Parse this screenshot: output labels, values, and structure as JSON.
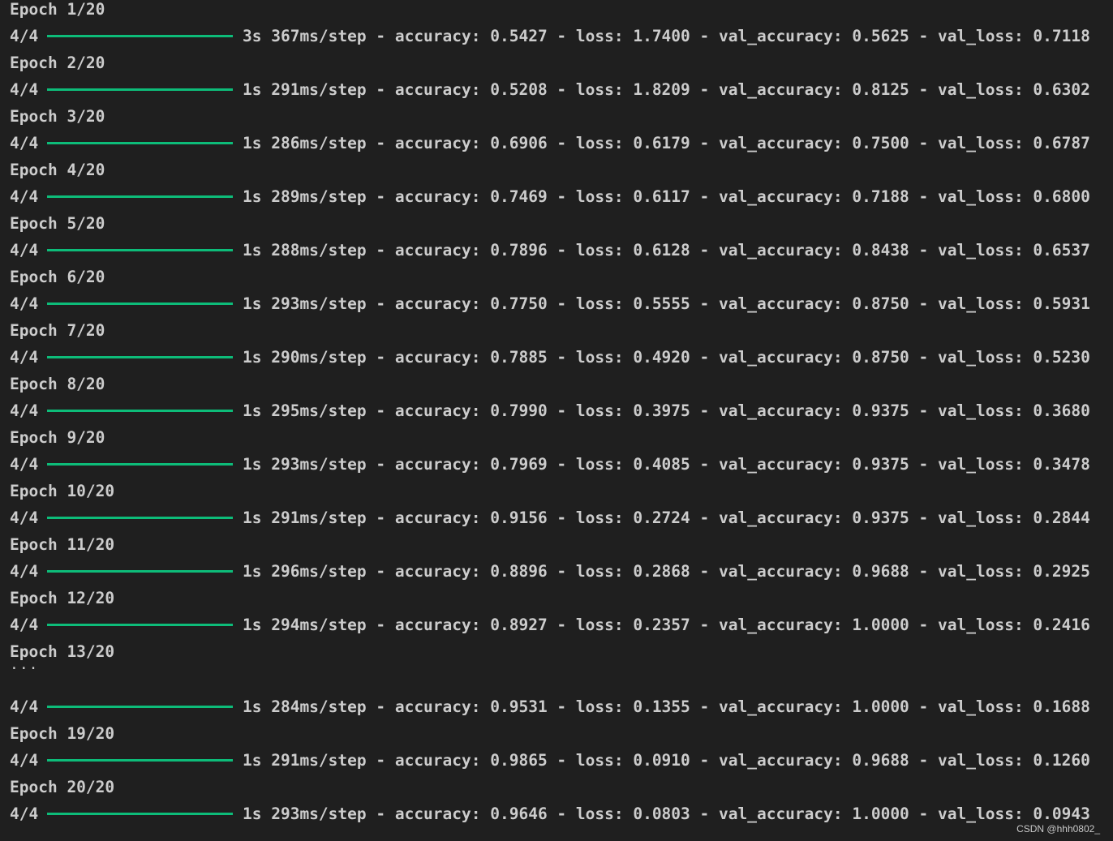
{
  "terminal": {
    "blocks": [
      {
        "epoch": "Epoch 1/20",
        "steps": "4/4",
        "stats": "3s 367ms/step - accuracy: 0.5427 - loss: 1.7400 - val_accuracy: 0.5625 - val_loss: 0.7118"
      },
      {
        "epoch": "Epoch 2/20",
        "steps": "4/4",
        "stats": "1s 291ms/step - accuracy: 0.5208 - loss: 1.8209 - val_accuracy: 0.8125 - val_loss: 0.6302"
      },
      {
        "epoch": "Epoch 3/20",
        "steps": "4/4",
        "stats": "1s 286ms/step - accuracy: 0.6906 - loss: 0.6179 - val_accuracy: 0.7500 - val_loss: 0.6787"
      },
      {
        "epoch": "Epoch 4/20",
        "steps": "4/4",
        "stats": "1s 289ms/step - accuracy: 0.7469 - loss: 0.6117 - val_accuracy: 0.7188 - val_loss: 0.6800"
      },
      {
        "epoch": "Epoch 5/20",
        "steps": "4/4",
        "stats": "1s 288ms/step - accuracy: 0.7896 - loss: 0.6128 - val_accuracy: 0.8438 - val_loss: 0.6537"
      },
      {
        "epoch": "Epoch 6/20",
        "steps": "4/4",
        "stats": "1s 293ms/step - accuracy: 0.7750 - loss: 0.5555 - val_accuracy: 0.8750 - val_loss: 0.5931"
      },
      {
        "epoch": "Epoch 7/20",
        "steps": "4/4",
        "stats": "1s 290ms/step - accuracy: 0.7885 - loss: 0.4920 - val_accuracy: 0.8750 - val_loss: 0.5230"
      },
      {
        "epoch": "Epoch 8/20",
        "steps": "4/4",
        "stats": "1s 295ms/step - accuracy: 0.7990 - loss: 0.3975 - val_accuracy: 0.9375 - val_loss: 0.3680"
      },
      {
        "epoch": "Epoch 9/20",
        "steps": "4/4",
        "stats": "1s 293ms/step - accuracy: 0.7969 - loss: 0.4085 - val_accuracy: 0.9375 - val_loss: 0.3478"
      },
      {
        "epoch": "Epoch 10/20",
        "steps": "4/4",
        "stats": "1s 291ms/step - accuracy: 0.9156 - loss: 0.2724 - val_accuracy: 0.9375 - val_loss: 0.2844"
      },
      {
        "epoch": "Epoch 11/20",
        "steps": "4/4",
        "stats": "1s 296ms/step - accuracy: 0.8896 - loss: 0.2868 - val_accuracy: 0.9688 - val_loss: 0.2925"
      },
      {
        "epoch": "Epoch 12/20",
        "steps": "4/4",
        "stats": "1s 294ms/step - accuracy: 0.8927 - loss: 0.2357 - val_accuracy: 1.0000 - val_loss: 0.2416"
      },
      {
        "epoch": "Epoch 13/20",
        "steps": null,
        "stats": null
      }
    ],
    "ellipsis": "...",
    "tail": [
      {
        "epoch": null,
        "steps": "4/4",
        "stats": "1s 284ms/step - accuracy: 0.9531 - loss: 0.1355 - val_accuracy: 1.0000 - val_loss: 0.1688"
      },
      {
        "epoch": "Epoch 19/20",
        "steps": "4/4",
        "stats": "1s 291ms/step - accuracy: 0.9865 - loss: 0.0910 - val_accuracy: 0.9688 - val_loss: 0.1260"
      },
      {
        "epoch": "Epoch 20/20",
        "steps": "4/4",
        "stats": "1s 293ms/step - accuracy: 0.9646 - loss: 0.0803 - val_accuracy: 1.0000 - val_loss: 0.0943"
      }
    ],
    "progress_bar_color": "#0dbc79",
    "progress_fraction": 1.0
  },
  "watermark": "CSDN @hhh0802_"
}
